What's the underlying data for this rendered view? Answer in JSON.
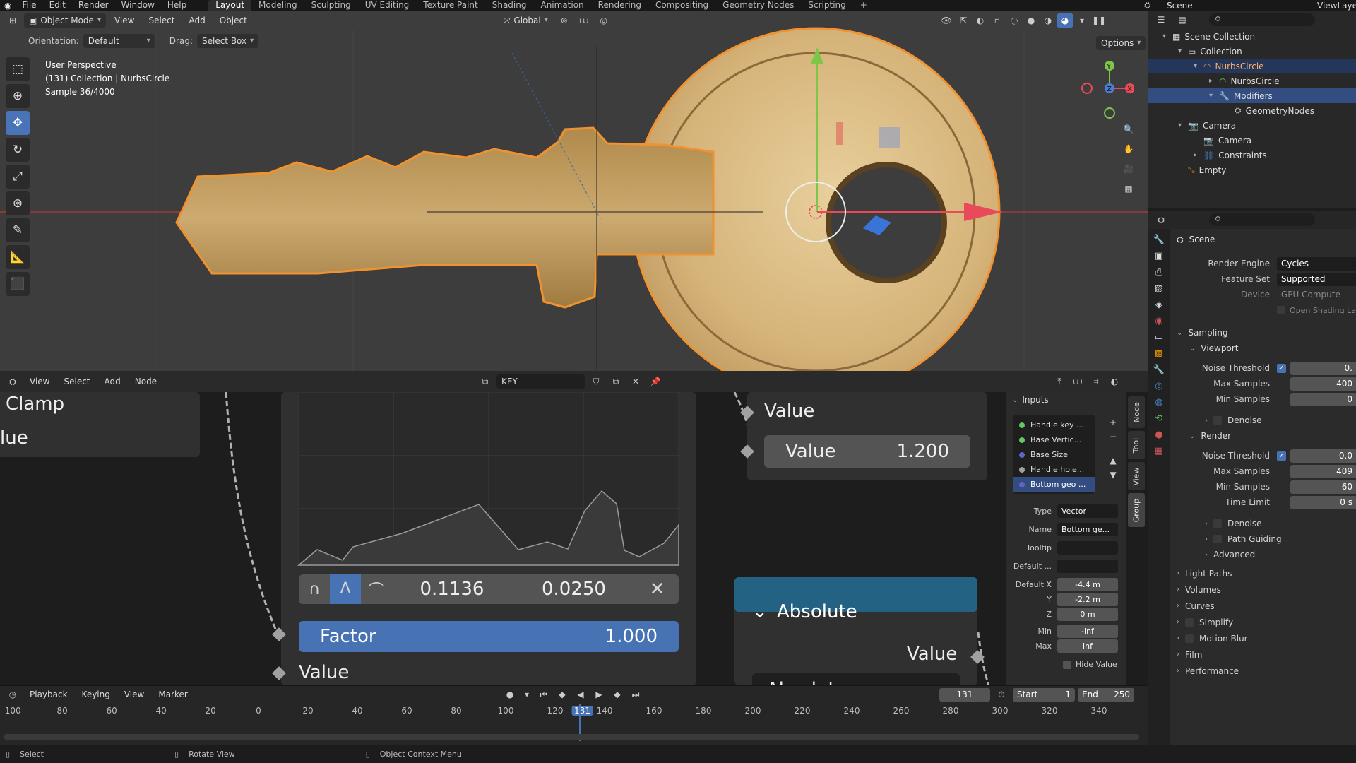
{
  "topbar": {
    "menus": [
      "File",
      "Edit",
      "Render",
      "Window",
      "Help"
    ],
    "workspaces": [
      "Layout",
      "Modeling",
      "Sculpting",
      "UV Editing",
      "Texture Paint",
      "Shading",
      "Animation",
      "Rendering",
      "Compositing",
      "Geometry Nodes",
      "Scripting"
    ],
    "add_tab": "+",
    "scene": "Scene",
    "view_layer": "ViewLayer"
  },
  "viewport": {
    "mode": "Object Mode",
    "menus": [
      "View",
      "Select",
      "Add",
      "Object"
    ],
    "transform_orientation": "Global",
    "orientation_label": "Orientation:",
    "orientation_value": "Default",
    "drag_label": "Drag:",
    "drag_value": "Select Box",
    "options": "Options",
    "overlay_line1": "User Perspective",
    "overlay_line2": "(131) Collection | NurbsCircle",
    "overlay_line3": "Sample 36/4000",
    "gizmo_y": "Y",
    "gizmo_z": "Z",
    "gizmo_x": "X"
  },
  "node_editor": {
    "menus": [
      "View",
      "Select",
      "Add",
      "Node"
    ],
    "tree_name": "KEY",
    "left_node_label1": "Clamp",
    "left_node_label2": "lue",
    "curve_x": "0.1136",
    "curve_y": "0.0250",
    "factor_label": "Factor",
    "factor_value": "1.000",
    "value_socket": "Value",
    "right_value_title": "Value",
    "right_value_label": "Value",
    "right_value_number": "1.200",
    "absolute_title": "Absolute",
    "absolute_out": "Value",
    "absolute_dropdown": "Absolute"
  },
  "group_panel": {
    "header": "Inputs",
    "items": [
      "Handle key ...",
      "Base Vertic...",
      "Base Size",
      "Handle hole...",
      "Bottom geo ..."
    ],
    "item_colors": [
      "#63c763",
      "#63c763",
      "#6363c7",
      "#a1a1a1",
      "#6363c7"
    ],
    "type_label": "Type",
    "type_value": "Vector",
    "name_label": "Name",
    "name_value": "Bottom ge...",
    "tooltip_label": "Tooltip",
    "tooltip_value": "",
    "default_label": "Default ...",
    "default_value": "",
    "defx_label": "Default X",
    "defx_value": "-4.4 m",
    "y_label": "Y",
    "y_value": "-2.2 m",
    "z_label": "Z",
    "z_value": "0 m",
    "min_label": "Min",
    "min_value": "-inf",
    "max_label": "Max",
    "max_value": "inf",
    "hide_value": "Hide Value",
    "tabs": [
      "Node",
      "Tool",
      "View",
      "Group"
    ]
  },
  "outliner": {
    "rows": [
      {
        "label": "Scene Collection",
        "indent": 0
      },
      {
        "label": "Collection",
        "indent": 1
      },
      {
        "label": "NurbsCircle",
        "indent": 2
      },
      {
        "label": "NurbsCircle",
        "indent": 3
      },
      {
        "label": "Modifiers",
        "indent": 3
      },
      {
        "label": "GeometryNodes",
        "indent": 4
      },
      {
        "label": "Camera",
        "indent": 1
      },
      {
        "label": "Camera",
        "indent": 2
      },
      {
        "label": "Constraints",
        "indent": 2
      },
      {
        "label": "Empty",
        "indent": 1
      }
    ]
  },
  "properties": {
    "context": "Scene",
    "render_engine_label": "Render Engine",
    "render_engine": "Cycles",
    "feature_set_label": "Feature Set",
    "feature_set": "Supported",
    "device_label": "Device",
    "device": "GPU Compute",
    "open_shading": "Open Shading La",
    "sampling": "Sampling",
    "viewport": "Viewport",
    "noise_threshold": "Noise Threshold",
    "vp_noise_value": "0.",
    "max_samples": "Max Samples",
    "vp_max_value": "400",
    "min_samples": "Min Samples",
    "vp_min_value": "0",
    "denoise": "Denoise",
    "render": "Render",
    "r_noise_value": "0.0",
    "r_max_value": "409",
    "r_min_value": "60",
    "time_limit": "Time Limit",
    "time_limit_value": "0 s",
    "path_guiding": "Path Guiding",
    "advanced": "Advanced",
    "sections": [
      "Light Paths",
      "Volumes",
      "Curves",
      "Simplify",
      "Motion Blur",
      "Film",
      "Performance"
    ]
  },
  "timeline": {
    "menus": [
      "Playback",
      "Keying",
      "View",
      "Marker"
    ],
    "current_frame": "131",
    "start_label": "Start",
    "start": "1",
    "end_label": "End",
    "end": "250",
    "ruler": [
      "-100",
      "-80",
      "-60",
      "-40",
      "-20",
      "0",
      "20",
      "40",
      "60",
      "80",
      "100",
      "120",
      "131",
      "140",
      "160",
      "180",
      "200",
      "220",
      "240",
      "260",
      "280",
      "300",
      "320",
      "340"
    ]
  },
  "status": {
    "items": [
      "Select",
      "Rotate View",
      "Object Context Menu"
    ]
  },
  "colors": {
    "accent": "#4772b3",
    "selection": "#334d80",
    "key": "#d9b377",
    "outline": "#f0922f"
  }
}
